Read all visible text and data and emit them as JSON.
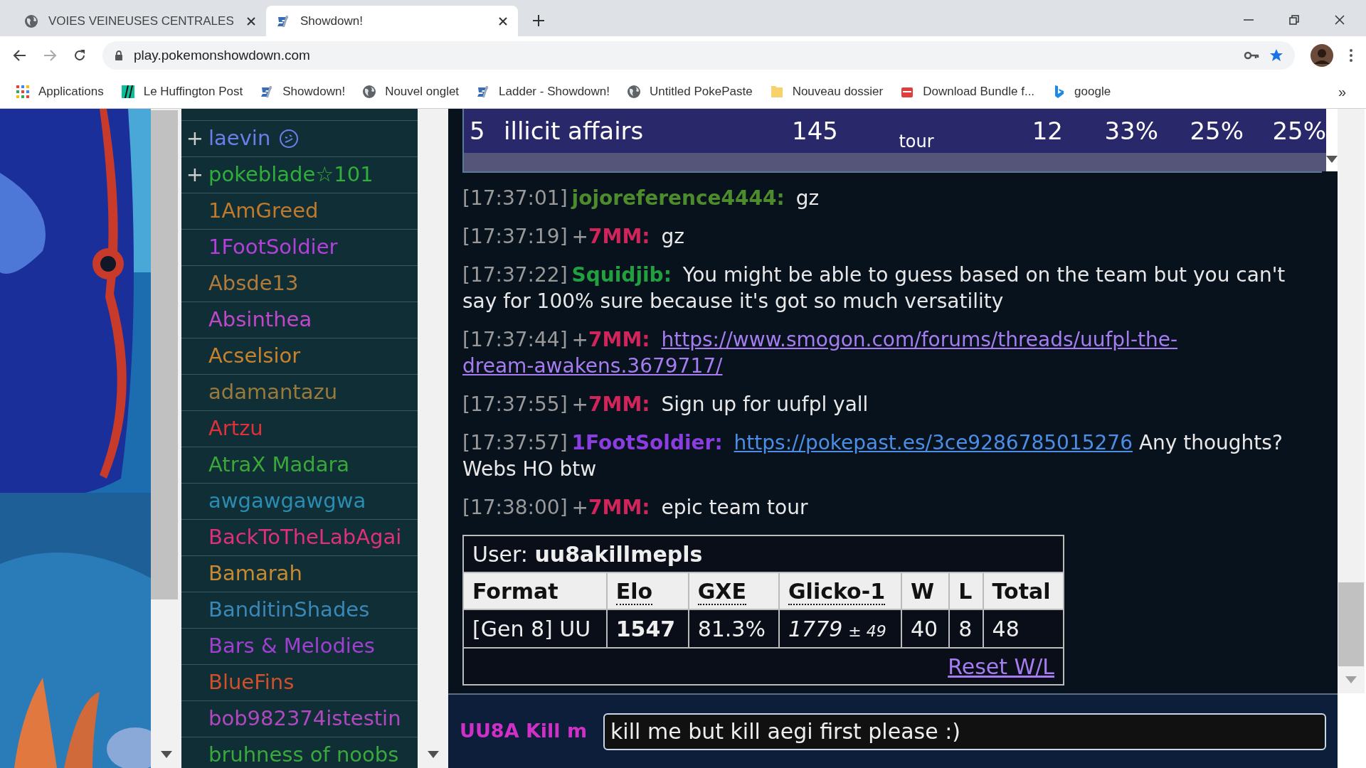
{
  "browser": {
    "tabs": [
      {
        "title": "VOIES VEINEUSES CENTRALES",
        "selected": false
      },
      {
        "title": "Showdown!",
        "selected": true
      }
    ],
    "url": "play.pokemonshowdown.com",
    "bookmarks": [
      {
        "label": "Applications"
      },
      {
        "label": "Le Huffington Post"
      },
      {
        "label": "Showdown!"
      },
      {
        "label": "Nouvel onglet"
      },
      {
        "label": "Ladder - Showdown!"
      },
      {
        "label": "Untitled PokePaste"
      },
      {
        "label": "Nouveau dossier"
      },
      {
        "label": "Download Bundle f..."
      },
      {
        "label": "google"
      }
    ],
    "more": "»"
  },
  "userlist": [
    {
      "prefix": "+",
      "name": "laevin",
      "color": "#6b7fe8",
      "away": true
    },
    {
      "prefix": "+",
      "name": "pokeblade☆101",
      "color": "#2fae3a"
    },
    {
      "name": "1AmGreed",
      "color": "#c07a2c"
    },
    {
      "name": "1FootSoldier",
      "color": "#b340d8"
    },
    {
      "name": "Absde13",
      "color": "#b07a3a"
    },
    {
      "name": "Absinthea",
      "color": "#c048c8"
    },
    {
      "name": "Acselsior",
      "color": "#c8822e"
    },
    {
      "name": "adamantazu",
      "color": "#9a7a3a"
    },
    {
      "name": "Artzu",
      "color": "#e0303a"
    },
    {
      "name": "AtraX Madara",
      "color": "#3aa838"
    },
    {
      "name": "awgawgawgwa",
      "color": "#2a8cb0"
    },
    {
      "name": "BackToTheLabAgai",
      "color": "#e0307a"
    },
    {
      "name": "Bamarah",
      "color": "#c88a30"
    },
    {
      "name": "BanditinShades",
      "color": "#3a88b8"
    },
    {
      "name": "Bars & Melodies",
      "color": "#a040d0"
    },
    {
      "name": "BlueFins",
      "color": "#d0502a"
    },
    {
      "name": "bob982374istestin",
      "color": "#b048c0"
    },
    {
      "name": "bruhness of noobs",
      "color": "#3aa83a"
    }
  ],
  "tournament_row": [
    "5",
    "illicit affairs",
    "145",
    "tour",
    "12",
    "33%",
    "25%",
    "25%"
  ],
  "chat": [
    {
      "time": "[17:37:01]",
      "user": "jojoreference4444:",
      "color": "#4d8c2c",
      "parts": [
        {
          "kind": "text",
          "text": "gz"
        }
      ]
    },
    {
      "time": "[17:37:19]",
      "rank": "+",
      "user": "7MM:",
      "color": "#d0245a",
      "parts": [
        {
          "kind": "text",
          "text": "gz"
        }
      ]
    },
    {
      "time": "[17:37:22]",
      "user": "Squidjib:",
      "color": "#22a040",
      "parts": [
        {
          "kind": "text",
          "text": "You might be able to guess based on the team but you can't say for 100% sure because it's got so much versatility"
        }
      ]
    },
    {
      "time": "[17:37:44]",
      "rank": "+",
      "user": "7MM:",
      "color": "#d0245a",
      "parts": [
        {
          "kind": "link",
          "text": "https://www.smogon.com/forums/threads/uufpl-the-",
          "visited": true
        },
        {
          "kind": "link",
          "text": "dream-awakens.3679717/",
          "visited": true
        }
      ]
    },
    {
      "time": "[17:37:55]",
      "rank": "+",
      "user": "7MM:",
      "color": "#d0245a",
      "parts": [
        {
          "kind": "text",
          "text": "Sign up for uufpl yall"
        }
      ]
    },
    {
      "time": "[17:37:57]",
      "user": "1FootSoldier:",
      "color": "#8a3de0",
      "parts": [
        {
          "kind": "link",
          "text": "https://pokepast.es/3ce9286785015276",
          "visited": false
        },
        {
          "kind": "text",
          "text": "Any thoughts? Webs HO btw"
        }
      ]
    },
    {
      "time": "[17:38:00]",
      "rank": "+",
      "user": "7MM:",
      "color": "#d0245a",
      "parts": [
        {
          "kind": "text",
          "text": "epic team tour"
        }
      ]
    }
  ],
  "ladder": {
    "user_label": "User:",
    "user": "uu8akillmepls",
    "columns": [
      {
        "label": "Format",
        "dotted": false
      },
      {
        "label": "Elo",
        "dotted": true
      },
      {
        "label": "GXE",
        "dotted": true
      },
      {
        "label": "Glicko-1",
        "dotted": true
      },
      {
        "label": "W",
        "dotted": false
      },
      {
        "label": "L",
        "dotted": false
      },
      {
        "label": "Total",
        "dotted": false
      }
    ],
    "row": {
      "format": "[Gen 8] UU",
      "elo": "1547",
      "gxe": "81.3%",
      "glicko": "1779",
      "deviation": "± 49",
      "w": "40",
      "l": "8",
      "total": "48"
    },
    "reset": "Reset W/L"
  },
  "compose": {
    "name": "UU8A Kill m",
    "value": "kill me but kill aegi first please :)"
  }
}
